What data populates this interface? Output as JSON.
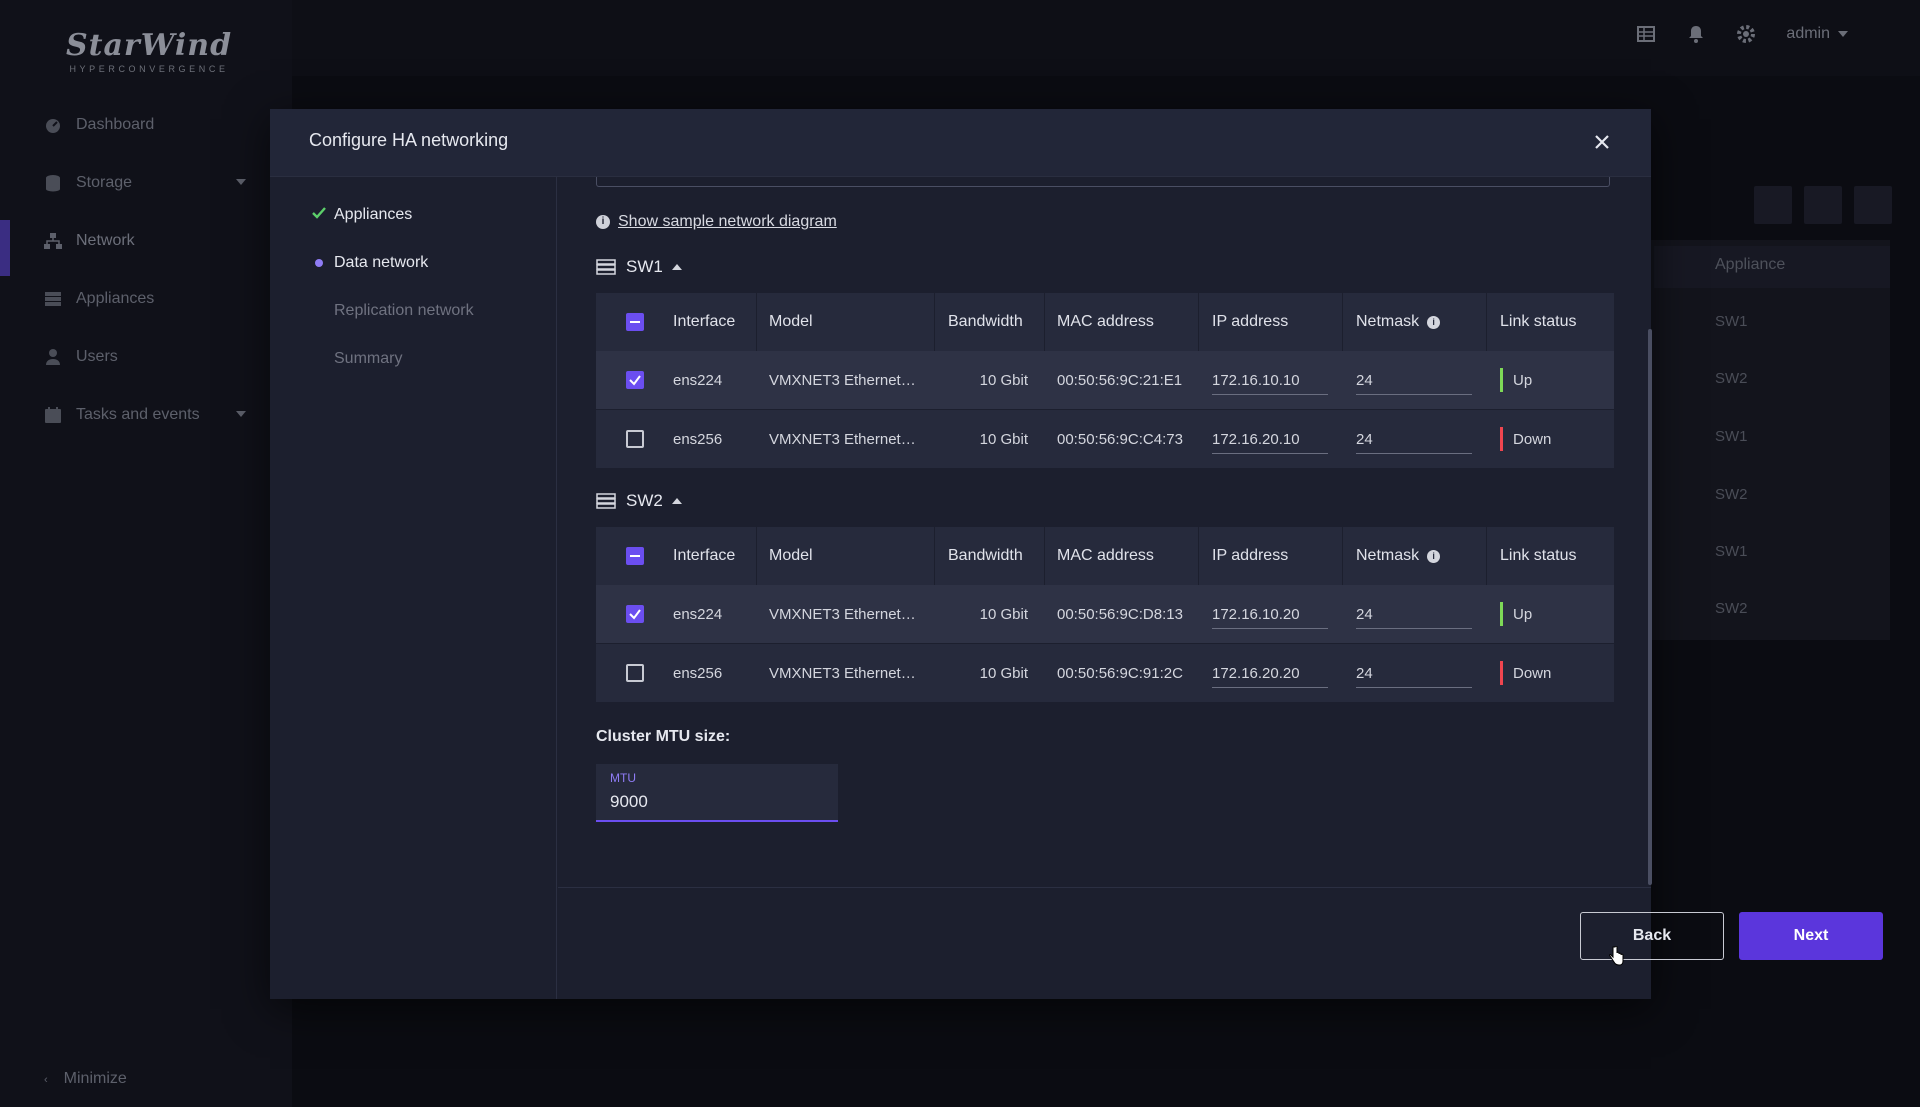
{
  "app": {
    "logo_text": "StarWind",
    "logo_sub": "HYPERCONVERGENCE",
    "user": "admin"
  },
  "sidebar": {
    "items": [
      {
        "label": "Dashboard",
        "icon": "dashboard-icon"
      },
      {
        "label": "Storage",
        "icon": "storage-icon"
      },
      {
        "label": "Network",
        "icon": "network-icon",
        "active": true
      },
      {
        "label": "Appliances",
        "icon": "appliances-icon"
      },
      {
        "label": "Users",
        "icon": "users-icon"
      },
      {
        "label": "Tasks and events",
        "icon": "tasks-icon"
      }
    ],
    "minimize": "Minimize"
  },
  "background_table": {
    "column": "Appliance",
    "cells": [
      "SW1",
      "SW2",
      "SW1",
      "SW2",
      "SW1",
      "SW2"
    ]
  },
  "modal": {
    "title": "Configure HA networking",
    "steps": [
      {
        "label": "Appliances",
        "state": "done"
      },
      {
        "label": "Data network",
        "state": "current"
      },
      {
        "label": "Replication network",
        "state": "pending"
      },
      {
        "label": "Summary",
        "state": "pending"
      }
    ],
    "sample_link": "Show sample network diagram",
    "columns": [
      "Interface",
      "Model",
      "Bandwidth",
      "MAC address",
      "IP address",
      "Netmask",
      "Link status"
    ],
    "switches": [
      {
        "name": "SW1",
        "rows": [
          {
            "checked": true,
            "interface": "ens224",
            "model": "VMXNET3 Ethernet…",
            "bandwidth": "10 Gbit",
            "mac": "00:50:56:9C:21:E1",
            "ip": "172.16.10.10",
            "netmask": "24",
            "status": "Up"
          },
          {
            "checked": false,
            "interface": "ens256",
            "model": "VMXNET3 Ethernet…",
            "bandwidth": "10 Gbit",
            "mac": "00:50:56:9C:C4:73",
            "ip": "172.16.20.10",
            "netmask": "24",
            "status": "Down"
          }
        ]
      },
      {
        "name": "SW2",
        "rows": [
          {
            "checked": true,
            "interface": "ens224",
            "model": "VMXNET3 Ethernet…",
            "bandwidth": "10 Gbit",
            "mac": "00:50:56:9C:D8:13",
            "ip": "172.16.10.20",
            "netmask": "24",
            "status": "Up"
          },
          {
            "checked": false,
            "interface": "ens256",
            "model": "VMXNET3 Ethernet…",
            "bandwidth": "10 Gbit",
            "mac": "00:50:56:9C:91:2C",
            "ip": "172.16.20.20",
            "netmask": "24",
            "status": "Down"
          }
        ]
      }
    ],
    "mtu": {
      "section_label": "Cluster MTU size:",
      "field_label": "MTU",
      "value": "9000"
    },
    "buttons": {
      "back": "Back",
      "next": "Next"
    }
  },
  "colors": {
    "accent": "#5b36dc",
    "status_up": "#7ed957",
    "status_down": "#f0454f",
    "check_done": "#5ccf6a"
  }
}
